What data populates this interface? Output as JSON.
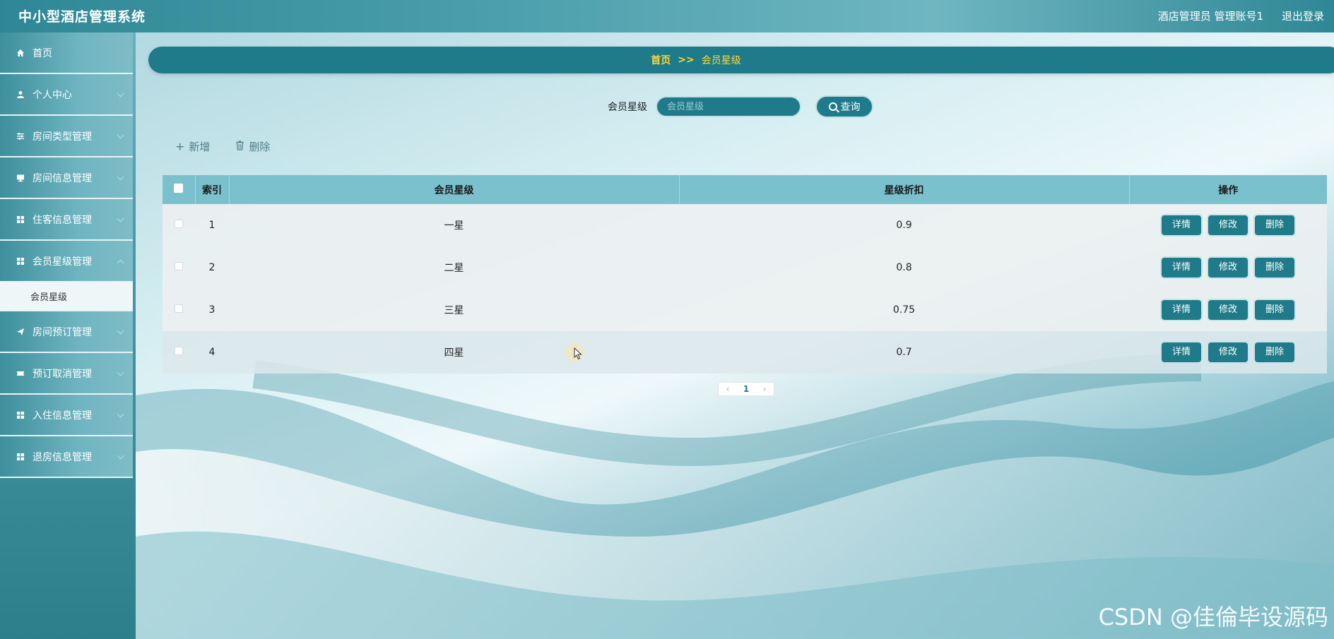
{
  "header": {
    "app_title": "中小型酒店管理系统",
    "user_info": "酒店管理员 管理账号1",
    "logout": "退出登录"
  },
  "sidebar": {
    "items": [
      {
        "label": "首页",
        "icon": "home-icon"
      },
      {
        "label": "个人中心",
        "icon": "user-icon"
      },
      {
        "label": "房间类型管理",
        "icon": "sliders-icon"
      },
      {
        "label": "房间信息管理",
        "icon": "monitor-icon"
      },
      {
        "label": "住客信息管理",
        "icon": "grid-icon"
      },
      {
        "label": "会员星级管理",
        "icon": "grid-icon"
      },
      {
        "label": "房间预订管理",
        "icon": "send-icon"
      },
      {
        "label": "预订取消管理",
        "icon": "ticket-icon"
      },
      {
        "label": "入住信息管理",
        "icon": "grid-icon"
      },
      {
        "label": "退房信息管理",
        "icon": "grid-icon"
      }
    ],
    "active_sub": "会员星级"
  },
  "breadcrumb": {
    "home": "首页",
    "separator": ">>",
    "current": "会员星级"
  },
  "search": {
    "label": "会员星级",
    "placeholder": "会员星级",
    "button": "查询"
  },
  "actions": {
    "add": "新增",
    "delete": "删除"
  },
  "table": {
    "columns": [
      "索引",
      "会员星级",
      "星级折扣",
      "操作"
    ],
    "rows": [
      {
        "index": "1",
        "level": "一星",
        "discount": "0.9"
      },
      {
        "index": "2",
        "level": "二星",
        "discount": "0.8"
      },
      {
        "index": "3",
        "level": "三星",
        "discount": "0.75"
      },
      {
        "index": "4",
        "level": "四星",
        "discount": "0.7"
      }
    ],
    "row_buttons": {
      "detail": "详情",
      "edit": "修改",
      "delete": "删除"
    }
  },
  "pagination": {
    "current_page": "1",
    "prev": "‹",
    "next": "›"
  },
  "watermark": "CSDN @佳倫毕设源码",
  "colors": {
    "primary": "#1f7b89",
    "breadcrumb_text": "#ffd53a",
    "table_header": "#7ac1cd"
  }
}
